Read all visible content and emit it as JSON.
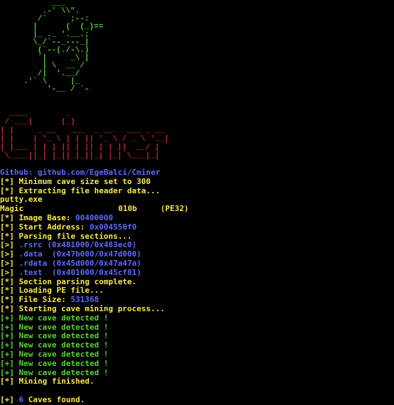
{
  "colors": {
    "background": "#000000",
    "art": "#4ec934",
    "logo": "#c0282a",
    "text": "#f6e64b",
    "value": "#5c68ff",
    "found": "#57d232",
    "github": "#5c68ff"
  },
  "ascii_art": "           ___\n         .-' \\\\\".\n        /`     ;--:\n       |      (  (_)==\n       |_ ._ '.__.;\n       \\_/`--_---_|\n        (`--(./-\\.)\n        `|     _\\ |\n         | \\  __ /\n        /|  '.__/\n     .'` \\     |_\n          '-__ / `-",
  "logo_art": "  ____        _\n / ___|      (_)\n| |     _ __   ___  _ __   ___ _ __\n| |    | '_ \\ | | || '_ \\ / _ \\ '__|\n| |___ | | | || | || | | ||  __/ |\n \\____||_| |_||_|_||_| |_| \\___|_|",
  "github": "Github: github.com/EgeBalci/Cminer",
  "lines": {
    "min_cave": "[*] Minimum cave size set to 300",
    "extract": "[*] Extracting file header data...",
    "file_name": "putty.exe",
    "magic_label": "Magic",
    "magic_value": "010b",
    "magic_type": "(PE32)",
    "image_base_label": "[*] Image Base: ",
    "image_base_value": "00400000",
    "start_addr_label": "[*] Start Address: ",
    "start_addr_value": "0x004550f0",
    "parsing": "[*] Parsing file sections...",
    "sections": [
      {
        "prefix": "[>] ",
        "name": ".rsrc ",
        "range": "(0x481000/0x483ec0)"
      },
      {
        "prefix": "[>] ",
        "name": ".data  ",
        "range": "(0x47b000/0x47d000)"
      },
      {
        "prefix": "[>] ",
        "name": ".rdata ",
        "range": "(0x45d000/0x47a47a)"
      },
      {
        "prefix": "[>] ",
        "name": ".text  ",
        "range": "(0x401000/0x45cf81)"
      }
    ],
    "parse_done": "[*] Section parsing complete.",
    "loading": "[*] Loading PE file...",
    "file_size_label": "[*] File Size: ",
    "file_size_value": "531368",
    "start_mining": "[*] Starting cave mining process...",
    "caves": [
      "[+] New cave detected !",
      "[+] New cave detected !",
      "[+] New cave detected !",
      "[+] New cave detected !",
      "[+] New cave detected !",
      "[+] New cave detected !",
      "[+] New cave detected !"
    ],
    "mining_done": "[*] Mining finished.",
    "found_prefix": "[+] ",
    "found_count": "6",
    "found_suffix": " Caves found."
  }
}
